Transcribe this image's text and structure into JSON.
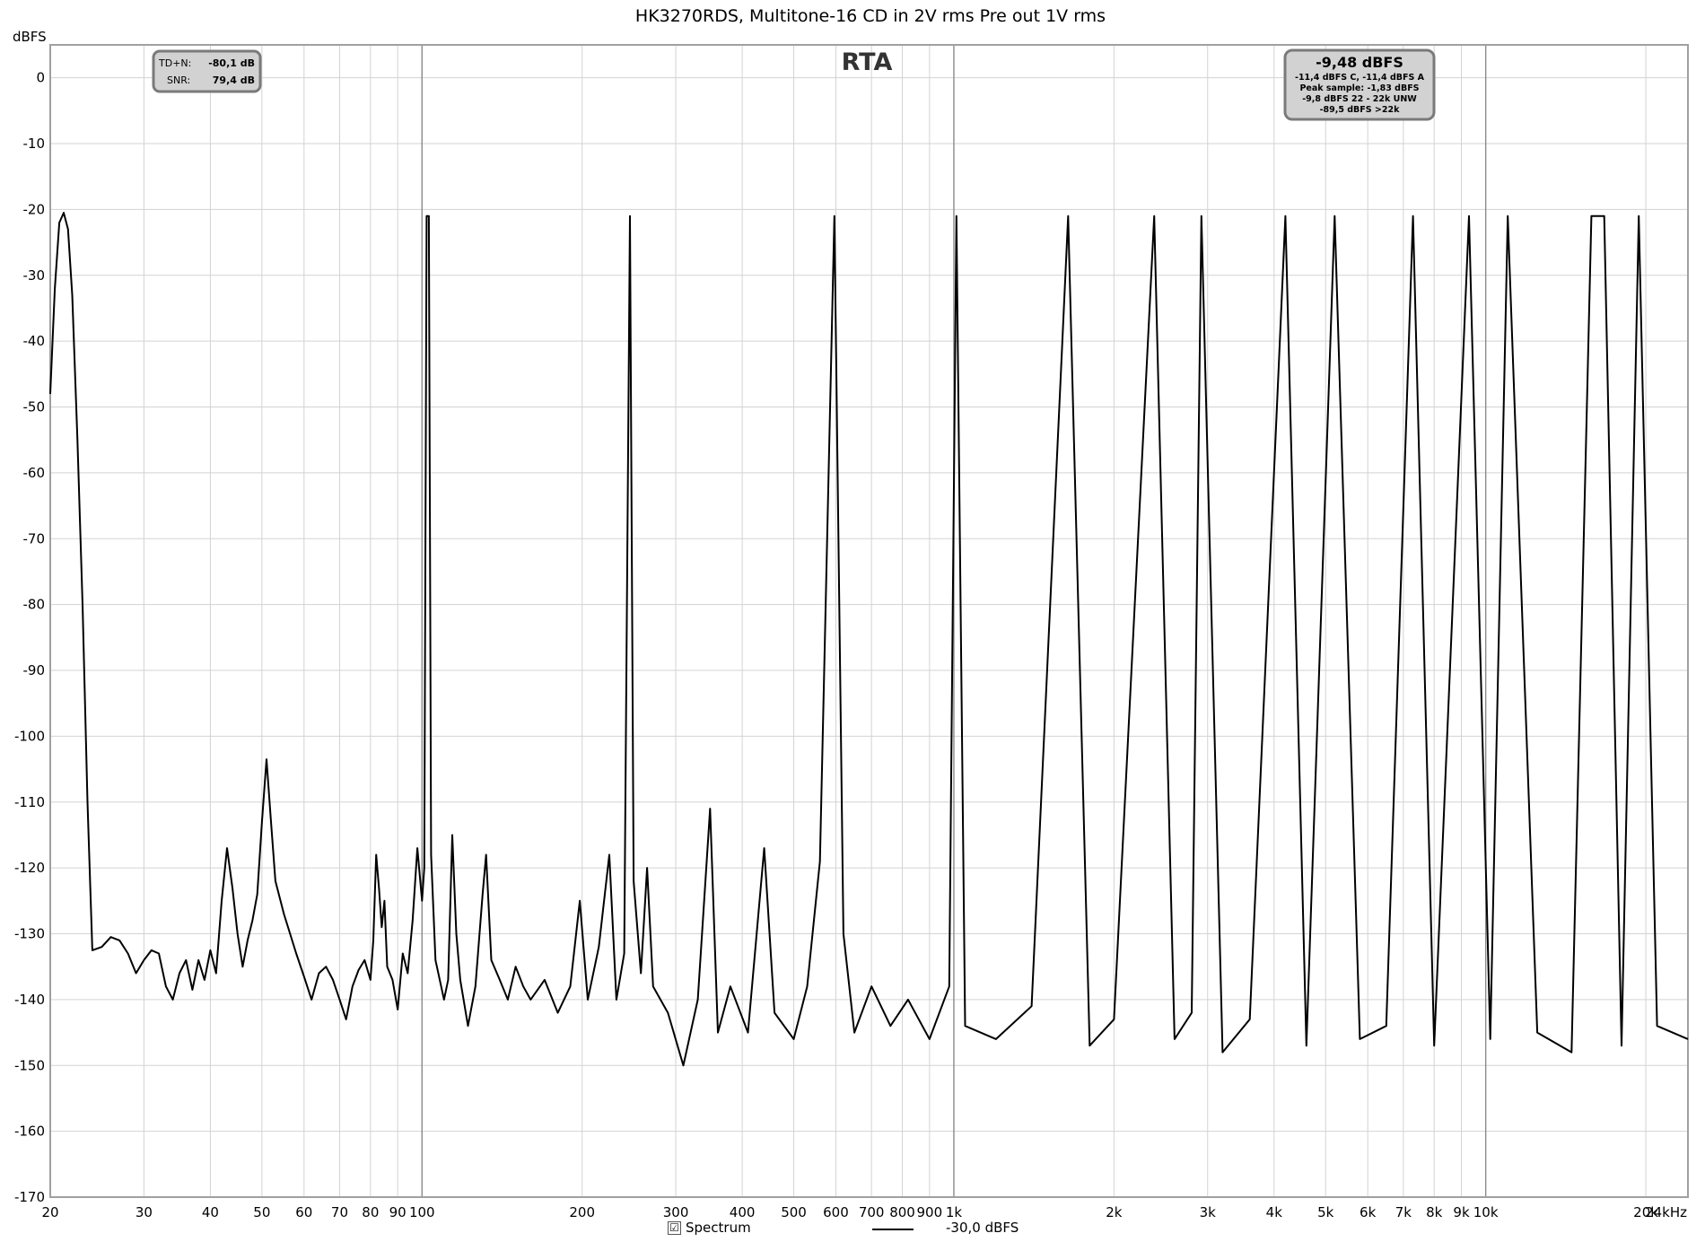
{
  "chart_data": {
    "type": "line",
    "title": "HK3270RDS, Multitone-16 CD in 2V rms Pre out 1V rms",
    "plot_label": "RTA",
    "ylabel": "dBFS",
    "xscale": "log",
    "xlim": [
      20,
      24000
    ],
    "ylim": [
      -170,
      5
    ],
    "y_ticks": [
      0,
      -10,
      -20,
      -30,
      -40,
      -50,
      -60,
      -70,
      -80,
      -90,
      -100,
      -110,
      -120,
      -130,
      -140,
      -150,
      -160,
      -170
    ],
    "x_ticks": [
      {
        "value": 20,
        "label": "20"
      },
      {
        "value": 30,
        "label": "30"
      },
      {
        "value": 40,
        "label": "40"
      },
      {
        "value": 50,
        "label": "50"
      },
      {
        "value": 60,
        "label": "60"
      },
      {
        "value": 70,
        "label": "70"
      },
      {
        "value": 80,
        "label": "80"
      },
      {
        "value": 90,
        "label": "90"
      },
      {
        "value": 100,
        "label": "100"
      },
      {
        "value": 200,
        "label": "200"
      },
      {
        "value": 300,
        "label": "300"
      },
      {
        "value": 400,
        "label": "400"
      },
      {
        "value": 500,
        "label": "500"
      },
      {
        "value": 600,
        "label": "600"
      },
      {
        "value": 700,
        "label": "700"
      },
      {
        "value": 800,
        "label": "800"
      },
      {
        "value": 900,
        "label": "900"
      },
      {
        "value": 1000,
        "label": "1k"
      },
      {
        "value": 2000,
        "label": "2k"
      },
      {
        "value": 3000,
        "label": "3k"
      },
      {
        "value": 4000,
        "label": "4k"
      },
      {
        "value": 5000,
        "label": "5k"
      },
      {
        "value": 6000,
        "label": "6k"
      },
      {
        "value": 7000,
        "label": "7k"
      },
      {
        "value": 8000,
        "label": "8k"
      },
      {
        "value": 9000,
        "label": "9k"
      },
      {
        "value": 10000,
        "label": "10k"
      },
      {
        "value": 20000,
        "label": "20k"
      },
      {
        "value": 24000,
        "label": "24kHz"
      }
    ],
    "grid": true,
    "series": [
      {
        "name": "Spectrum",
        "color": "#000000",
        "points": [
          [
            20,
            -48
          ],
          [
            20.4,
            -32
          ],
          [
            20.8,
            -22
          ],
          [
            21.2,
            -20.5
          ],
          [
            21.6,
            -23
          ],
          [
            22,
            -33
          ],
          [
            22.5,
            -55
          ],
          [
            23,
            -80
          ],
          [
            23.5,
            -110
          ],
          [
            24,
            -132.5
          ],
          [
            25,
            -132
          ],
          [
            26,
            -130.5
          ],
          [
            27,
            -131
          ],
          [
            28,
            -133
          ],
          [
            29,
            -136
          ],
          [
            30,
            -134
          ],
          [
            31,
            -132.5
          ],
          [
            32,
            -133
          ],
          [
            33,
            -138
          ],
          [
            34,
            -140
          ],
          [
            35,
            -136
          ],
          [
            36,
            -134
          ],
          [
            37,
            -138.5
          ],
          [
            38,
            -134
          ],
          [
            39,
            -137
          ],
          [
            40,
            -132.5
          ],
          [
            41,
            -136
          ],
          [
            42,
            -125
          ],
          [
            43,
            -117
          ],
          [
            44,
            -123
          ],
          [
            45,
            -130
          ],
          [
            46,
            -135
          ],
          [
            47,
            -131
          ],
          [
            48,
            -128
          ],
          [
            49,
            -124
          ],
          [
            50,
            -113
          ],
          [
            51,
            -103.5
          ],
          [
            52,
            -113
          ],
          [
            53,
            -122
          ],
          [
            55,
            -127
          ],
          [
            58,
            -133
          ],
          [
            60,
            -136.5
          ],
          [
            62,
            -140
          ],
          [
            64,
            -136
          ],
          [
            66,
            -135
          ],
          [
            68,
            -137
          ],
          [
            70,
            -140
          ],
          [
            72,
            -143
          ],
          [
            74,
            -138
          ],
          [
            76,
            -135.5
          ],
          [
            78,
            -134
          ],
          [
            80,
            -137
          ],
          [
            81,
            -131
          ],
          [
            82,
            -118
          ],
          [
            83,
            -123
          ],
          [
            84,
            -129
          ],
          [
            85,
            -125
          ],
          [
            86,
            -135
          ],
          [
            88,
            -137
          ],
          [
            90,
            -141.5
          ],
          [
            92,
            -133
          ],
          [
            94,
            -136
          ],
          [
            96,
            -128
          ],
          [
            98,
            -117
          ],
          [
            100,
            -125
          ],
          [
            101,
            -120
          ],
          [
            102,
            -21
          ],
          [
            103,
            -21
          ],
          [
            104,
            -118
          ],
          [
            106,
            -134
          ],
          [
            110,
            -140
          ],
          [
            112,
            -137
          ],
          [
            114,
            -115
          ],
          [
            116,
            -130
          ],
          [
            118,
            -137
          ],
          [
            122,
            -144
          ],
          [
            126,
            -138
          ],
          [
            130,
            -124
          ],
          [
            132,
            -118
          ],
          [
            135,
            -134
          ],
          [
            140,
            -137
          ],
          [
            145,
            -140
          ],
          [
            150,
            -135
          ],
          [
            155,
            -138
          ],
          [
            160,
            -140
          ],
          [
            170,
            -137
          ],
          [
            180,
            -142
          ],
          [
            190,
            -138
          ],
          [
            198,
            -125
          ],
          [
            205,
            -140
          ],
          [
            215,
            -132
          ],
          [
            225,
            -118
          ],
          [
            232,
            -140
          ],
          [
            240,
            -133
          ],
          [
            246,
            -21
          ],
          [
            250,
            -122
          ],
          [
            258,
            -136
          ],
          [
            265,
            -120
          ],
          [
            272,
            -138
          ],
          [
            290,
            -142
          ],
          [
            310,
            -150
          ],
          [
            330,
            -140
          ],
          [
            348,
            -111
          ],
          [
            360,
            -145
          ],
          [
            380,
            -138
          ],
          [
            410,
            -145
          ],
          [
            440,
            -117
          ],
          [
            460,
            -142
          ],
          [
            500,
            -146
          ],
          [
            530,
            -138
          ],
          [
            560,
            -119
          ],
          [
            596,
            -21
          ],
          [
            620,
            -130
          ],
          [
            650,
            -145
          ],
          [
            700,
            -138
          ],
          [
            760,
            -144
          ],
          [
            820,
            -140
          ],
          [
            900,
            -146
          ],
          [
            980,
            -138
          ],
          [
            1011,
            -21
          ],
          [
            1050,
            -144
          ],
          [
            1200,
            -146
          ],
          [
            1400,
            -141
          ],
          [
            1640,
            -21
          ],
          [
            1800,
            -147
          ],
          [
            2000,
            -143
          ],
          [
            2380,
            -21
          ],
          [
            2600,
            -146
          ],
          [
            2800,
            -142
          ],
          [
            2920,
            -21
          ],
          [
            3200,
            -148
          ],
          [
            3600,
            -143
          ],
          [
            4200,
            -21
          ],
          [
            4600,
            -147
          ],
          [
            5200,
            -21
          ],
          [
            5800,
            -146
          ],
          [
            6500,
            -144
          ],
          [
            7300,
            -21
          ],
          [
            8000,
            -147
          ],
          [
            9300,
            -21
          ],
          [
            10200,
            -146
          ],
          [
            11000,
            -21
          ],
          [
            12500,
            -145
          ],
          [
            14500,
            -148
          ],
          [
            15800,
            -21
          ],
          [
            16700,
            -21
          ],
          [
            18000,
            -147
          ],
          [
            19400,
            -21
          ],
          [
            21000,
            -144
          ],
          [
            24000,
            -146
          ]
        ]
      }
    ],
    "annotations": {
      "thd_box": {
        "tdn_label": "TD+N:",
        "tdn_value": "-80,1 dB",
        "snr_label": "SNR:",
        "snr_value": "79,4 dB"
      },
      "level_box": {
        "main": "-9,48 dBFS",
        "line1": "-11,4 dBFS C, -11,4 dBFS A",
        "line2": "Peak sample: -1,83 dBFS",
        "line3": "-9,8 dBFS 22 - 22k UNW",
        "line4": "-89,5 dBFS >22k"
      }
    },
    "legend": {
      "position": "bottom",
      "checkbox": "☑",
      "label": "Spectrum",
      "level": "-30,0 dBFS"
    }
  }
}
